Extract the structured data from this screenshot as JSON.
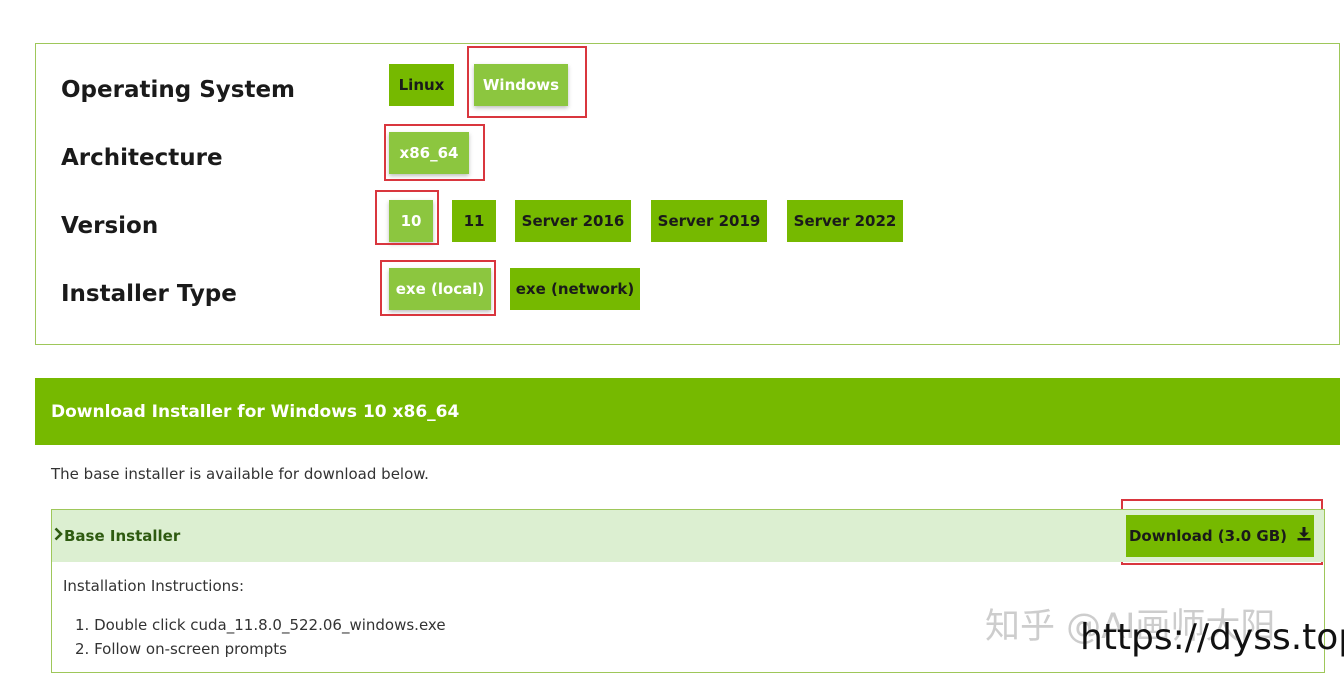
{
  "selector": {
    "rows": [
      {
        "label": "Operating System",
        "options": [
          "Linux",
          "Windows"
        ],
        "selected": "Windows"
      },
      {
        "label": "Architecture",
        "options": [
          "x86_64"
        ],
        "selected": "x86_64"
      },
      {
        "label": "Version",
        "options": [
          "10",
          "11",
          "Server 2016",
          "Server 2019",
          "Server 2022"
        ],
        "selected": "10"
      },
      {
        "label": "Installer Type",
        "options": [
          "exe (local)",
          "exe (network)"
        ],
        "selected": "exe (local)"
      }
    ]
  },
  "download": {
    "header": "Download Installer for Windows 10 x86_64",
    "description": "The base installer is available for download below.",
    "base_installer": {
      "title": "Base Installer",
      "button_label": "Download (3.0 GB)",
      "instructions_title": "Installation Instructions:",
      "steps": [
        "1. Double click cuda_11.8.0_522.06_windows.exe",
        "2. Follow on-screen prompts"
      ]
    }
  },
  "watermark": {
    "text": "知乎 @AI画师大阳",
    "url": "https://dyss.top"
  },
  "colors": {
    "accent": "#76b900",
    "selected": "#8cc63f",
    "highlight": "#d9363e",
    "row_bg": "#dcefd1"
  },
  "icons": {
    "chevron": "chevron-right-icon",
    "download": "download-icon"
  }
}
